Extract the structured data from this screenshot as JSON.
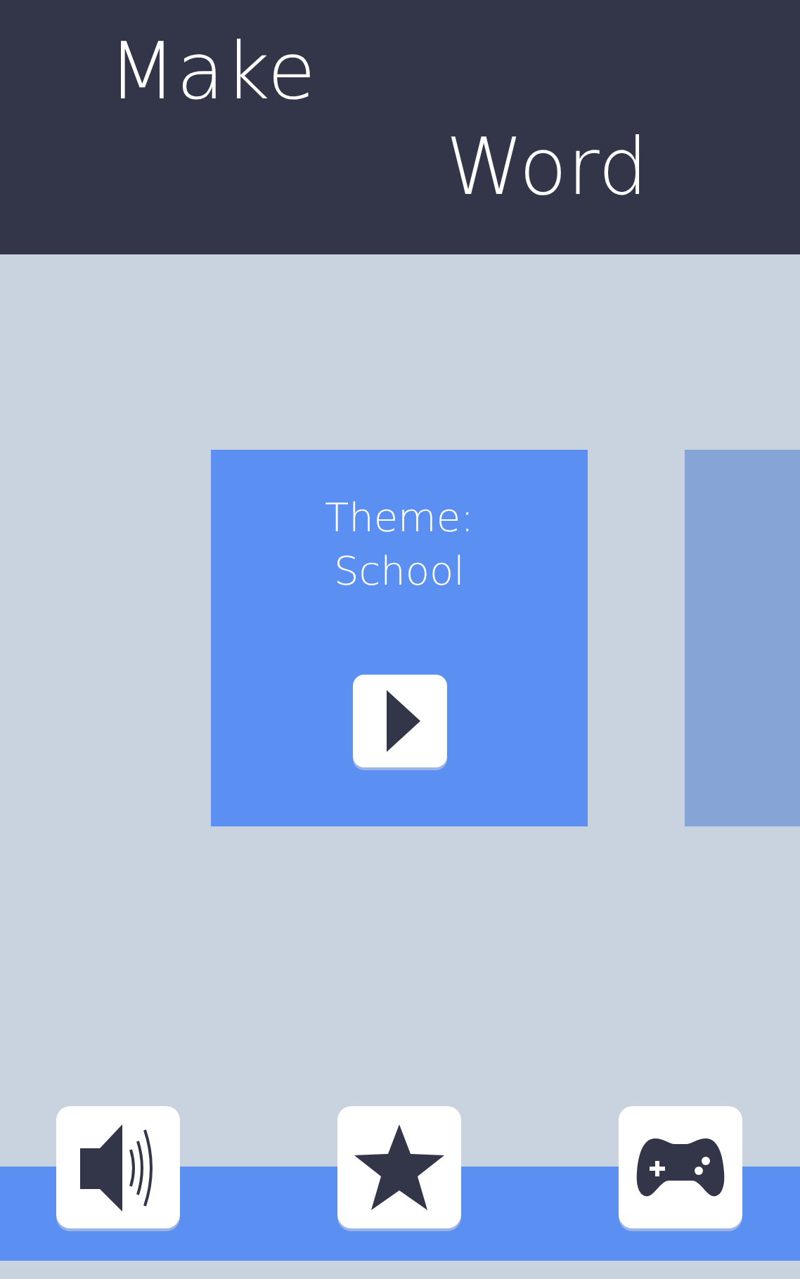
{
  "title": {
    "lines": [
      "Make",
      "Word"
    ]
  },
  "themes": [
    {
      "label": "Theme:\nSchool",
      "selected": true
    },
    {
      "selected": false
    }
  ],
  "toolbar": [
    {
      "kind": "sound"
    },
    {
      "kind": "favorites"
    },
    {
      "kind": "games"
    }
  ]
}
